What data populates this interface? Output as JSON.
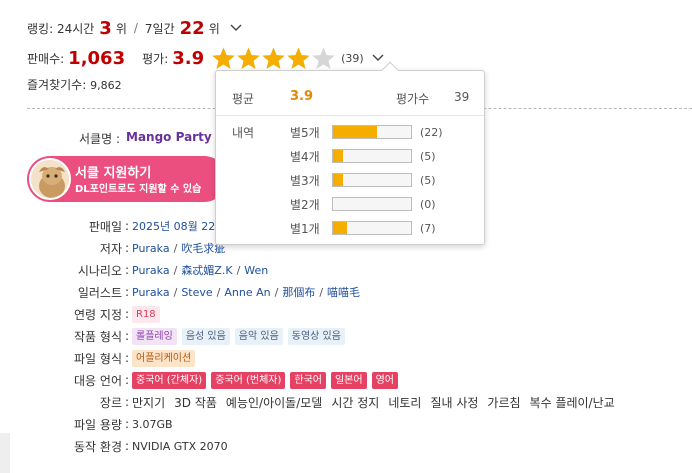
{
  "ranking": {
    "label_24h": "랭킹: 24시간",
    "rank_24h": "3",
    "unit": "위",
    "sep": "/",
    "label_7d": "7일간",
    "rank_7d": "22"
  },
  "sales": {
    "label": "판매수:",
    "count": "1,063",
    "rating_label": "평가:",
    "rating": "3.9",
    "star_value": 3.9,
    "reviews": "(39)"
  },
  "favorites": {
    "label": "즐겨찾기수:",
    "count": "9,862"
  },
  "circle": {
    "label": "서클명",
    "colon": ":",
    "name": "Mango Party"
  },
  "support": {
    "title": "서클 지원하기",
    "subtitle": "DL포인트로도 지원할 수 있습"
  },
  "info": {
    "colon": ":",
    "release_label": "판매일",
    "release_value": "2025년 08월 22",
    "author_label": "저자",
    "authors": [
      "Puraka",
      "吹毛求疵"
    ],
    "scenario_label": "시나리오",
    "scenario": [
      "Puraka",
      "森忒媚Z.K",
      "Wen"
    ],
    "illust_label": "일러스트",
    "illust": [
      "Puraka",
      "Steve",
      "Anne An",
      "那個布",
      "喵喵毛"
    ],
    "age_label": "연령 지정",
    "age_value": "R18",
    "format_label": "작품 형식",
    "format_tags": [
      "롤플레잉",
      "음성 있음",
      "음악 있음",
      "동영상 있음"
    ],
    "filetype_label": "파일 형식",
    "filetype_value": "어플리케이션",
    "lang_label": "대응 언어",
    "langs": [
      "중국어 (간체자)",
      "중국어 (번체자)",
      "한국어",
      "일본어",
      "영어"
    ],
    "genre_label": "장르",
    "genres": [
      "만지기",
      "3D 작품",
      "예능인/아이돌/모델",
      "시간 정지",
      "네토리",
      "질내 사정",
      "가르침",
      "복수 플레이/난교"
    ],
    "size_label": "파일 용량",
    "size_value": "3.07GB",
    "env_label": "동작 환경",
    "env_value": "NVIDIA GTX 2070"
  },
  "popup": {
    "avg_label": "평균",
    "avg_value": "3.9",
    "count_label": "평가수",
    "count_value": "39",
    "hist_label": "내역",
    "rows": [
      {
        "label": "별5개",
        "count": "(22)",
        "fraction": 0.564
      },
      {
        "label": "별4개",
        "count": "(5)",
        "fraction": 0.128
      },
      {
        "label": "별3개",
        "count": "(5)",
        "fraction": 0.128
      },
      {
        "label": "별2개",
        "count": "(0)",
        "fraction": 0.0
      },
      {
        "label": "별1개",
        "count": "(7)",
        "fraction": 0.179
      }
    ]
  },
  "colors": {
    "accent_red": "#c00000",
    "star_gold": "#f5ae00",
    "circle_purple": "#663399",
    "banner_pink": "#ea4f7f",
    "link_blue": "#1f4e9c"
  },
  "icons": [
    "chevron-down-icon",
    "star-icon"
  ]
}
